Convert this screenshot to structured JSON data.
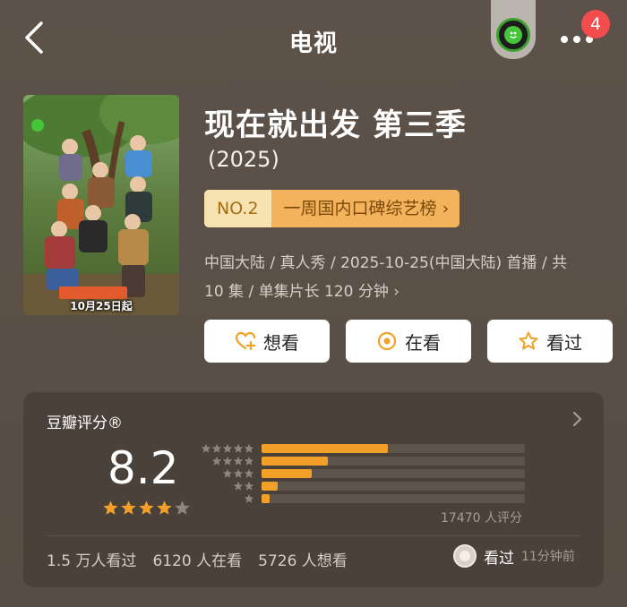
{
  "header": {
    "title": "电视",
    "notification_count": "4"
  },
  "show": {
    "title": "现在就出发 第三季",
    "year": "(2025)",
    "poster_date_text": "10月25日起",
    "rank": {
      "number": "NO.2",
      "label": "一周国内口碑综艺榜",
      "chevron": "›"
    },
    "meta_line1": "中国大陆 / 真人秀 / 2025-10-25(中国大陆) 首播 / 共",
    "meta_line2": "10 集 / 单集片长 120 分钟",
    "meta_chevron": "›"
  },
  "actions": [
    {
      "label": "想看",
      "icon": "heart-plus-icon"
    },
    {
      "label": "在看",
      "icon": "target-icon"
    },
    {
      "label": "看过",
      "icon": "star-outline-icon"
    }
  ],
  "rating": {
    "card_title": "豆瓣评分®",
    "score": "8.2",
    "star_rating": 4,
    "star_max": 5,
    "distribution": [
      {
        "stars": 5,
        "fraction": 0.48
      },
      {
        "stars": 4,
        "fraction": 0.25
      },
      {
        "stars": 3,
        "fraction": 0.19
      },
      {
        "stars": 2,
        "fraction": 0.06
      },
      {
        "stars": 1,
        "fraction": 0.03
      }
    ],
    "rating_count": "17470 人评分",
    "stats": {
      "watched": "1.5 万人看过",
      "watching": "6120 人在看",
      "want": "5726 人想看"
    },
    "friend": {
      "action": "看过",
      "time": "11分钟前"
    }
  },
  "colors": {
    "accent_orange": "#f2a028",
    "rank_pill": "#f3b35d",
    "background": "#5c5148",
    "card": "#4a413a"
  }
}
